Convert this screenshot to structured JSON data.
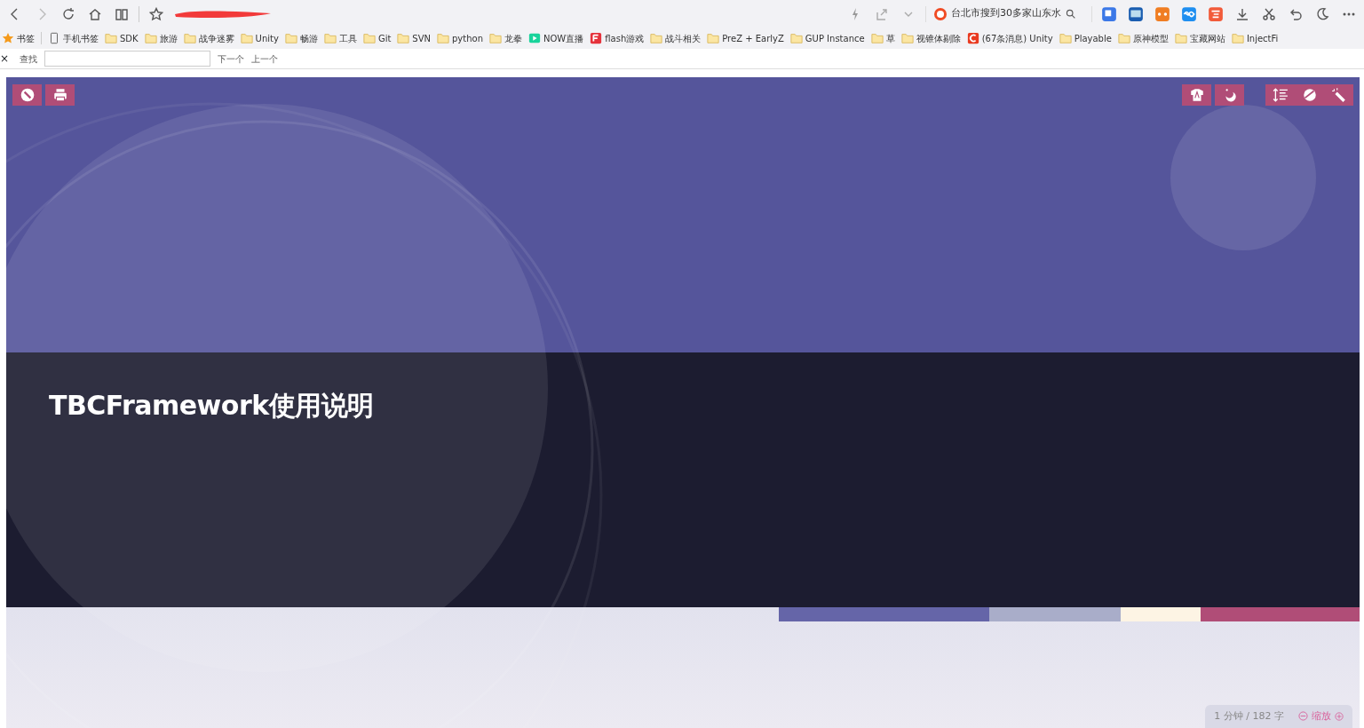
{
  "browser": {
    "search_box": {
      "value": "台北市搜到30多家山东水"
    },
    "bookmarks": [
      {
        "kind": "star",
        "label": "书签"
      },
      {
        "kind": "phone",
        "label": "手机书签"
      },
      {
        "kind": "folder",
        "label": "SDK"
      },
      {
        "kind": "folder",
        "label": "旅游"
      },
      {
        "kind": "folder",
        "label": "战争迷雾"
      },
      {
        "kind": "folder",
        "label": "Unity"
      },
      {
        "kind": "folder",
        "label": "畅游"
      },
      {
        "kind": "folder",
        "label": "工具"
      },
      {
        "kind": "folder",
        "label": "Git"
      },
      {
        "kind": "folder",
        "label": "SVN"
      },
      {
        "kind": "folder",
        "label": "python"
      },
      {
        "kind": "folder",
        "label": "龙拳"
      },
      {
        "kind": "now",
        "label": "NOW直播"
      },
      {
        "kind": "flash",
        "label": "flash游戏"
      },
      {
        "kind": "folder",
        "label": "战斗相关"
      },
      {
        "kind": "folder",
        "label": "PreZ + EarlyZ"
      },
      {
        "kind": "folder",
        "label": "GUP Instance"
      },
      {
        "kind": "folder",
        "label": "草"
      },
      {
        "kind": "folder",
        "label": "视锥体剔除"
      },
      {
        "kind": "csdn",
        "label": "(67条消息) Unity"
      },
      {
        "kind": "folder",
        "label": "Playable"
      },
      {
        "kind": "folder",
        "label": "原神模型"
      },
      {
        "kind": "folder",
        "label": "宝藏网站"
      },
      {
        "kind": "folder",
        "label": "InjectFi"
      }
    ],
    "find_bar": {
      "close": "×",
      "label": "查找",
      "next": "下一个",
      "previous": "上一个"
    }
  },
  "document": {
    "title": "TBCFramework使用说明",
    "color_strip": [
      {
        "color": "#6565a8"
      },
      {
        "color": "#a9adc9"
      },
      {
        "color": "#fdf4e4"
      },
      {
        "color": "#b04d77"
      }
    ],
    "status": {
      "reading": "1 分钟 / 182 字",
      "zoom": "缩放"
    }
  }
}
